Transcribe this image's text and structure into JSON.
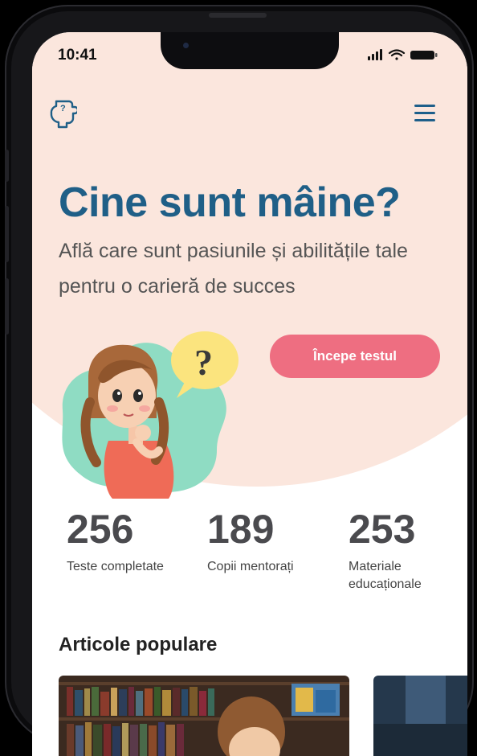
{
  "status_bar": {
    "time": "10:41"
  },
  "hero": {
    "title": "Cine sunt mâine?",
    "subtitle": "Află care sunt pasiunile și abilitățile tale pentru o carieră de succes",
    "cta_label": "Începe testul"
  },
  "stats": [
    {
      "value": "256",
      "label": "Teste completate"
    },
    {
      "value": "189",
      "label": "Copii mentorați"
    },
    {
      "value": "253",
      "label": "Materiale educaționale"
    }
  ],
  "articles": {
    "section_title": "Articole populare"
  },
  "colors": {
    "primary": "#1f5f87",
    "accent": "#ee6e81",
    "hero_background": "#fbe6dd",
    "blob": "#8fdcc3"
  }
}
